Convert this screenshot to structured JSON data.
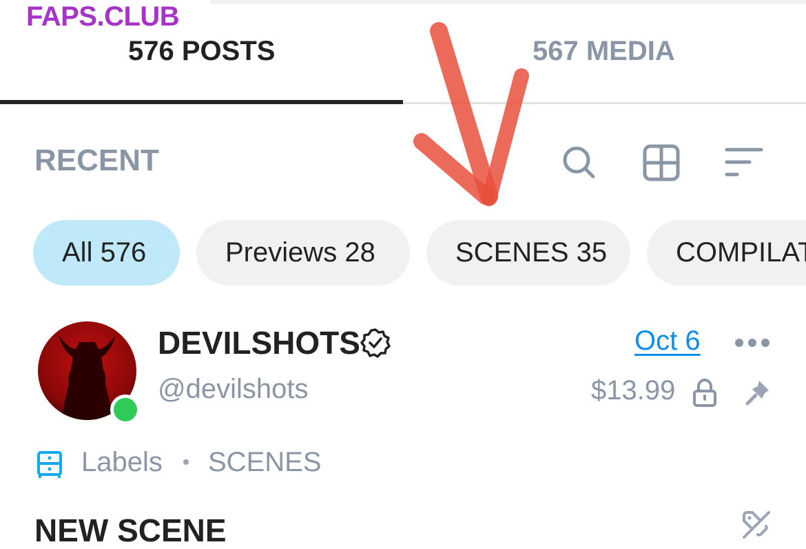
{
  "watermark": "FAPS.CLUB",
  "tabs": [
    {
      "label": "576 POSTS",
      "active": true
    },
    {
      "label": "567 MEDIA",
      "active": false
    }
  ],
  "section": {
    "title": "RECENT"
  },
  "toolbar": {
    "icons": [
      "search-icon",
      "grid-view-icon",
      "sort-icon"
    ]
  },
  "chips": [
    {
      "label": "All 576",
      "active": true
    },
    {
      "label": "Previews 28",
      "active": false
    },
    {
      "label": "SCENES 35",
      "active": false
    },
    {
      "label": "COMPILAT",
      "active": false
    }
  ],
  "post": {
    "author_name": "DEVILSHOTS",
    "handle": "@devilshots",
    "verified": true,
    "online": true,
    "date": "Oct 6",
    "price": "$13.99",
    "labels_label": "Labels",
    "labels_value": "SCENES",
    "title": "NEW SCENE"
  },
  "annotation": {
    "type": "hand-drawn arrow",
    "color": "#e8503c",
    "points_to": "SCENES 35"
  },
  "colors": {
    "accent": "#0c8ee9",
    "muted": "#8a96a6",
    "chip_active": "#bfe9f9",
    "chip": "#eff1f2",
    "watermark": "#a833c9",
    "online": "#2ecb5a"
  }
}
